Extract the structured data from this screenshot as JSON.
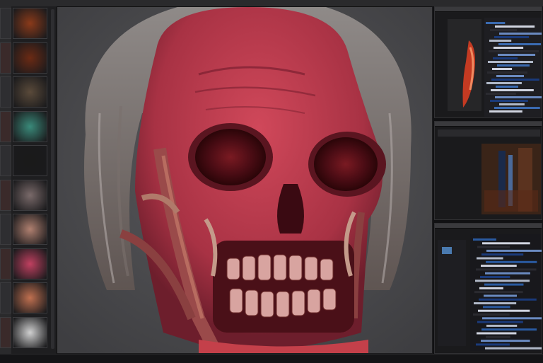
{
  "app": {
    "top_bar": "",
    "status_bar": ""
  },
  "left_panel": {
    "thumbnails": [
      {
        "icon": "fire-thumb-icon",
        "color": "#8a3a1a"
      },
      {
        "icon": "fire-thumb-icon",
        "color": "#6b2a14"
      },
      {
        "icon": "object-thumb-icon",
        "color": "#5a4a3a"
      },
      {
        "icon": "teal-thumb-icon",
        "color": "#3a8a7a"
      },
      {
        "icon": "silhouette-thumb-icon",
        "color": "#1a1a1a"
      },
      {
        "icon": "figure-thumb-icon",
        "color": "#7a6a6a"
      },
      {
        "icon": "skin-thumb-icon",
        "color": "#b08070"
      },
      {
        "icon": "texture-thumb-icon",
        "color": "#c04060"
      },
      {
        "icon": "hand-thumb-icon",
        "color": "#c07050"
      },
      {
        "icon": "white-thumb-icon",
        "color": "#d0d0d0"
      }
    ]
  },
  "viewport": {
    "subject_icon": "skull-portrait-icon"
  },
  "right_panels": [
    {
      "name": "preview",
      "accent": "#3a6ab0"
    },
    {
      "name": "layers",
      "accent": "#8a4a2a"
    },
    {
      "name": "timeline",
      "accent": "#2a5aa0"
    }
  ]
}
